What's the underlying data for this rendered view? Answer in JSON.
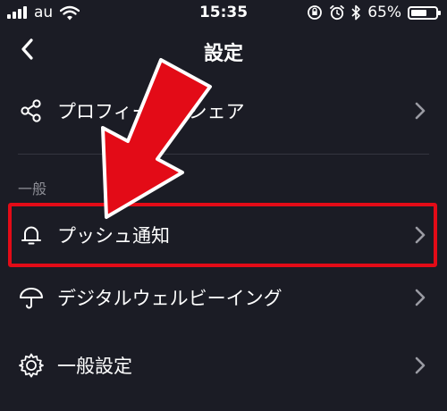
{
  "status_bar": {
    "carrier": "au",
    "time": "15:35",
    "battery_percent": "65%",
    "battery_level": 0.65,
    "icons": [
      "signal-icon",
      "wifi-icon",
      "rotation-lock-icon",
      "alarm-icon",
      "bluetooth-icon",
      "battery-icon"
    ]
  },
  "nav": {
    "title": "設定",
    "back_icon": "chevron-left-icon"
  },
  "rows": {
    "profile_share": {
      "label": "プロフィールをシェア",
      "icon": "share-icon"
    },
    "push_notification": {
      "label": "プッシュ通知",
      "icon": "bell-icon"
    },
    "digital_wellbeing": {
      "label": "デジタルウェルビーイング",
      "icon": "umbrella-icon"
    },
    "general_settings": {
      "label": "一般設定",
      "icon": "gear-icon"
    }
  },
  "sections": {
    "general_header": "一般"
  },
  "colors": {
    "background": "#1b1c25",
    "text": "#ffffff",
    "muted": "#8c8d95",
    "highlight": "#e30b17"
  }
}
